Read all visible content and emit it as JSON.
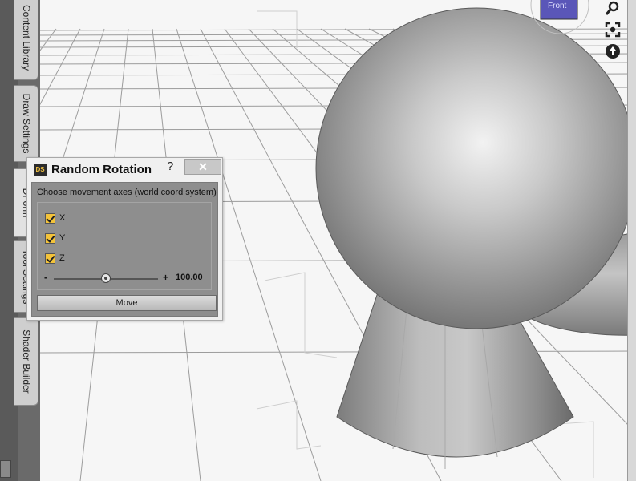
{
  "side_tabs": [
    {
      "label": "Content Library"
    },
    {
      "label": "Draw Settings"
    },
    {
      "label": "DForm"
    },
    {
      "label": "Tool Settings"
    },
    {
      "label": "Shader Builder"
    }
  ],
  "viewport": {
    "cube_label": "Front",
    "controls": [
      "zoom-icon",
      "frame-icon",
      "orbit-icon"
    ]
  },
  "dialog": {
    "logo": "DS",
    "title": "Random Rotation",
    "help": "?",
    "close": "✕",
    "axes_label": "Choose movement axes (world coord system)",
    "axes": [
      {
        "label": "X",
        "checked": true
      },
      {
        "label": "Y",
        "checked": true
      },
      {
        "label": "Z",
        "checked": true
      }
    ],
    "slider": {
      "minus": "-",
      "plus": "+",
      "value": "100.00"
    },
    "button": "Move"
  },
  "colors": {
    "checkbox": "#f3c33a",
    "panel": "#8e8e8e"
  }
}
